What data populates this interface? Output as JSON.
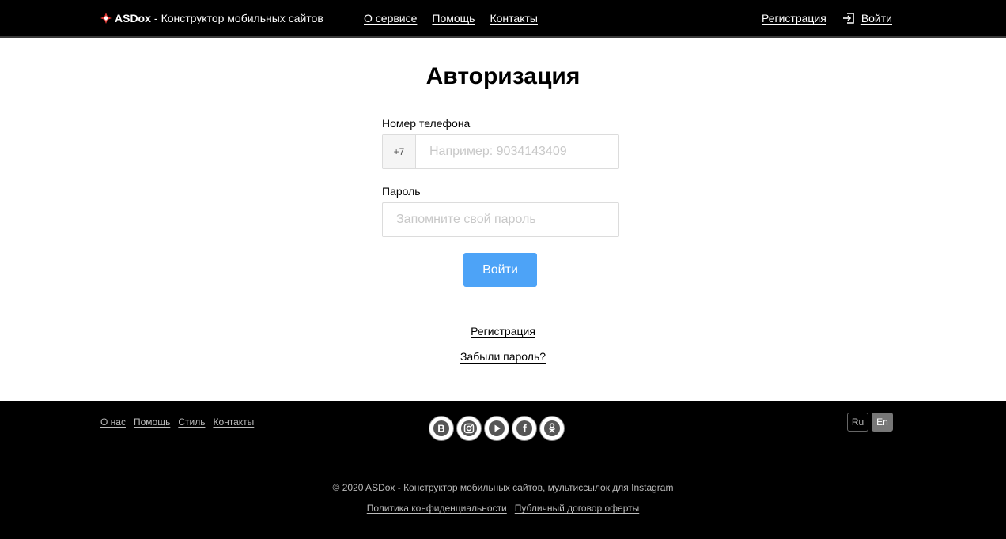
{
  "header": {
    "brand_name": "ASDox",
    "brand_separator": "-",
    "brand_tagline": "Конструктор мобильных сайтов",
    "nav": [
      {
        "label": "О сервисе"
      },
      {
        "label": "Помощь"
      },
      {
        "label": "Контакты"
      }
    ],
    "register_label": "Регистрация",
    "login_label": "Войти"
  },
  "auth_form": {
    "title": "Авторизация",
    "phone_label": "Номер телефона",
    "phone_prefix": "+7",
    "phone_placeholder": "Например: 9034143409",
    "phone_value": "",
    "password_label": "Пароль",
    "password_placeholder": "Запомните свой пароль",
    "password_value": "",
    "submit_label": "Войти",
    "register_link": "Регистрация",
    "forgot_link": "Забыли пароль?"
  },
  "footer": {
    "nav": [
      {
        "label": "О нас"
      },
      {
        "label": "Помощь"
      },
      {
        "label": "Стиль"
      },
      {
        "label": "Контакты"
      }
    ],
    "social_icons": [
      "vk-icon",
      "instagram-icon",
      "youtube-icon",
      "facebook-icon",
      "odnoklassniki-icon"
    ],
    "languages": [
      {
        "label": "Ru",
        "active": false
      },
      {
        "label": "En",
        "active": true
      }
    ],
    "copyright": "© 2020 ASDox - Конструктор мобильных сайтов, мультиссылок для Instagram",
    "legal": [
      {
        "label": "Политика конфиденциальности"
      },
      {
        "label": "Публичный договор оферты"
      }
    ]
  },
  "colors": {
    "header_bg": "#000000",
    "footer_bg": "#000000",
    "primary_button": "#4da3f7",
    "brand_logo": "#e53935"
  }
}
